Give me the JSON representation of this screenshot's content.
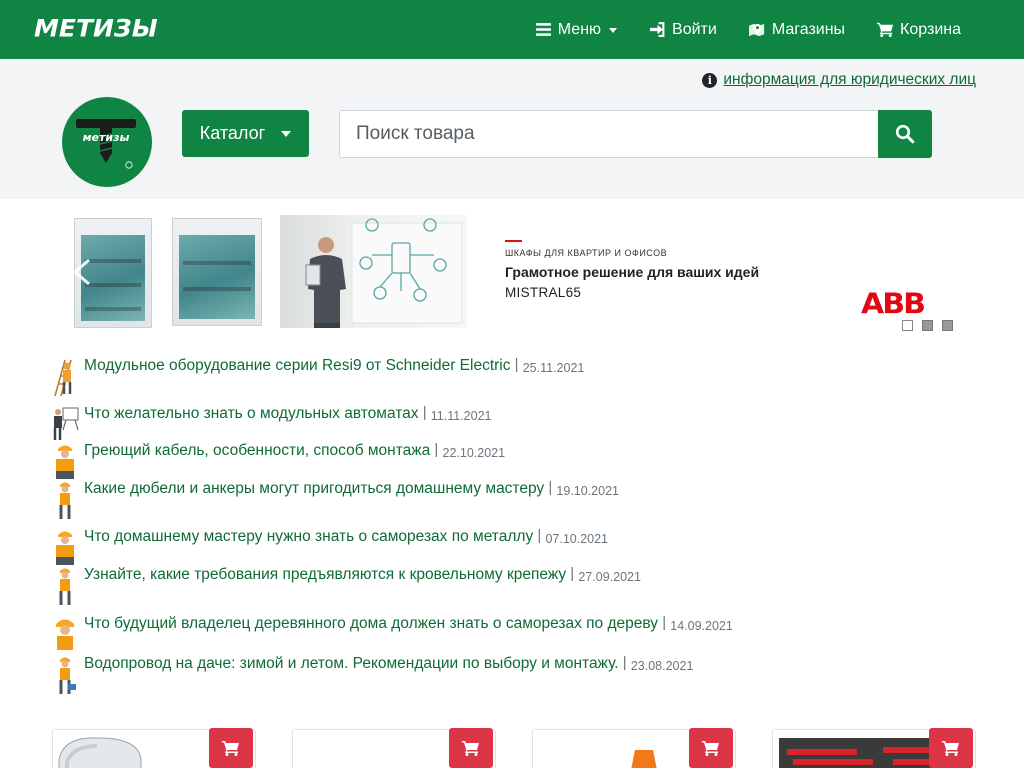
{
  "nav": {
    "brand": "МЕТИЗЫ",
    "menu": "Меню",
    "login": "Войти",
    "stores": "Магазины",
    "cart": "Корзина"
  },
  "header": {
    "legal_link": "информация для юридических лиц",
    "catalog": "Каталог",
    "search_placeholder": "Поиск товара",
    "logo_text": "метизы"
  },
  "banner": {
    "small": "ШКАФЫ ДЛЯ КВАРТИР И ОФИСОВ",
    "title": "Грамотное решение для ваших идей",
    "subtitle": "MISTRAL65",
    "brand": "ABB",
    "slides": 3,
    "active_slide": 1
  },
  "news": [
    {
      "title": "Модульное оборудование серии Resi9 от Schneider Electric",
      "date": "25.11.2021"
    },
    {
      "title": "Что желательно знать о модульных автоматах",
      "date": "11.11.2021"
    },
    {
      "title": "Греющий кабель, особенности, способ монтажа",
      "date": "22.10.2021"
    },
    {
      "title": "Какие дюбели и анкеры могут пригодиться домашнему мастеру",
      "date": "19.10.2021"
    },
    {
      "title": "Что домашнему мастеру нужно знать о саморезах по металлу",
      "date": "07.10.2021"
    },
    {
      "title": "Узнайте, какие требования предъявляются к кровельному крепежу",
      "date": "27.09.2021"
    },
    {
      "title": "Что будущий владелец деревянного дома должен знать о саморезах по дереву",
      "date": "14.09.2021"
    },
    {
      "title": "Водопровод на даче: зимой и летом. Рекомендации по выбору и монтажу.",
      "date": "23.08.2021"
    }
  ],
  "colors": {
    "brand_green": "#0f8443",
    "cart_red": "#dc3545",
    "link_green": "#0f6b36"
  }
}
